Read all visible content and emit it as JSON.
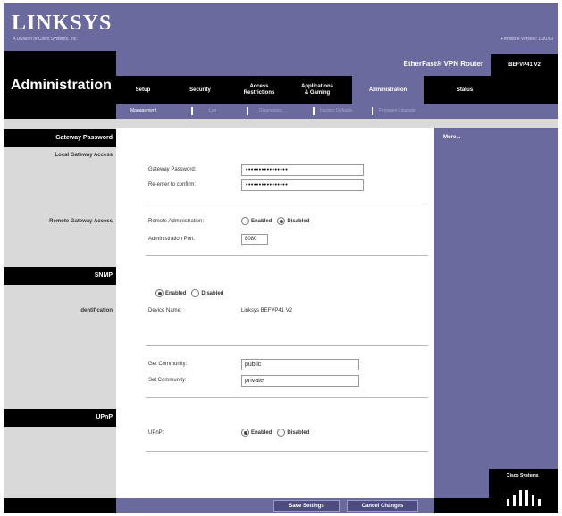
{
  "brand": {
    "logo": "LINKSYS",
    "tagline": "A Division of Cisco Systems, Inc.",
    "firmware": "Firmware Version: 1.00.03"
  },
  "header": {
    "page_title": "Administration",
    "product_name": "EtherFast® VPN Router",
    "model": "BEFVP41 V2"
  },
  "tabs": [
    {
      "label": "Setup"
    },
    {
      "label": "Security"
    },
    {
      "label": "Access\nRestrictions"
    },
    {
      "label": "Applications\n& Gaming"
    },
    {
      "label": "Administration"
    },
    {
      "label": "Status"
    }
  ],
  "subtabs": [
    {
      "label": "Management"
    },
    {
      "label": "Log"
    },
    {
      "label": "Diagnostics"
    },
    {
      "label": "Factory Defaults"
    },
    {
      "label": "Firmware Upgrade"
    }
  ],
  "sections": {
    "gateway_password": "Gateway Password",
    "local_gateway_access": "Local Gateway Access",
    "remote_gateway_access": "Remote Gateway Access",
    "snmp": "SNMP",
    "identification": "Identification",
    "upnp": "UPnP"
  },
  "form": {
    "gateway_password_label": "Gateway Password:",
    "gateway_password_value": "••••••••••••••••",
    "reenter_label": "Re-enter to confirm:",
    "reenter_value": "••••••••••••••••",
    "remote_admin_label": "Remote Administration:",
    "admin_port_label": "Administration Port:",
    "admin_port_value": "8080",
    "enabled": "Enabled",
    "disabled": "Disabled",
    "device_name_label": "Device Name:",
    "device_name_value": "Linksys BEFVP41 V2",
    "get_community_label": "Get Community:",
    "get_community_value": "public",
    "set_community_label": "Set Community:",
    "set_community_value": "private",
    "upnp_label": "UPnP:"
  },
  "help": {
    "more": "More..."
  },
  "buttons": {
    "save": "Save Settings",
    "cancel": "Cancel Changes"
  },
  "footer": {
    "cisco": "Cisco Systems"
  }
}
